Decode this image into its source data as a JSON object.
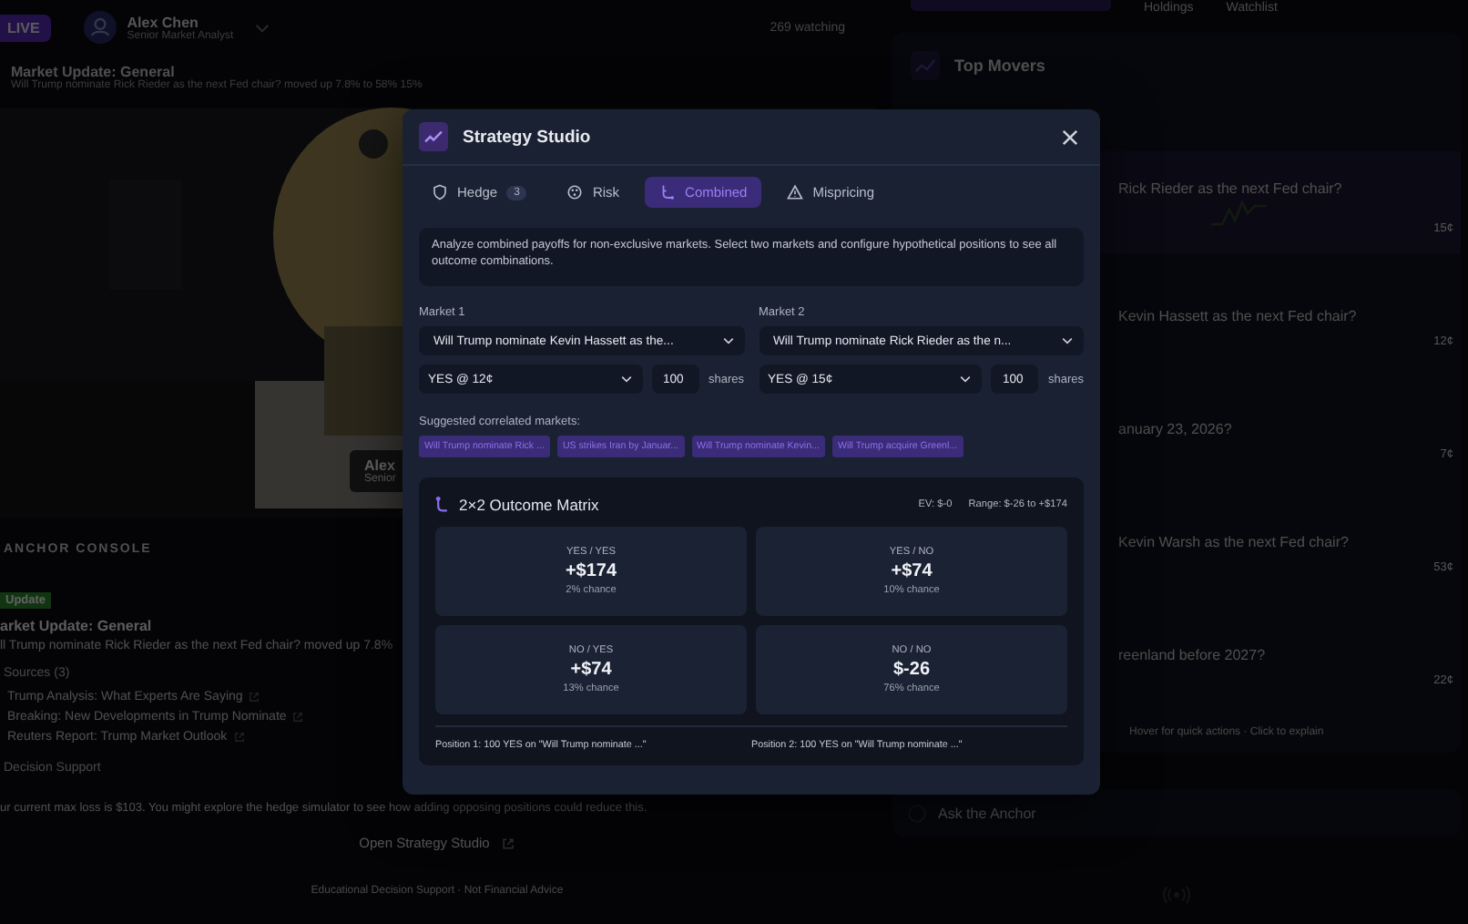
{
  "header": {
    "live_badge": "LIVE",
    "user_name": "Alex Chen",
    "user_role": "Senior Market Analyst",
    "viewers": "269 watching"
  },
  "ticker": {
    "title": "Market Update: General",
    "text": "Will Trump nominate Rick Rieder as the next Fed chair? moved up 7.8% to 58% 15%"
  },
  "video": {
    "kind": "picture",
    "name": "Alex",
    "role": "Senior"
  },
  "console": {
    "title": "ANCHOR CONSOLE",
    "badge": "Update",
    "headline": "arket Update: General",
    "text": "ll Trump nominate Rick Rieder as the next Fed chair? moved up 7.8%",
    "sources_title": "Sources (3)",
    "sources": [
      "Trump Analysis: What Experts Are Saying",
      "Breaking: New Developments in Trump Nominate",
      "Reuters Report: Trump Market Outlook"
    ],
    "decision_title": "Decision Support",
    "decision_text": "ur current max loss is $103. You might explore the hedge simulator to see how adding opposing positions could reduce this.",
    "open_button": "Open Strategy Studio",
    "footer": "Educational Decision Support · Not Financial Advice"
  },
  "side_tabs": [
    {
      "label": "Holdings",
      "selected": false
    },
    {
      "label": "Watchlist",
      "selected": false
    }
  ],
  "top_movers": {
    "title": "Top Movers",
    "rows": [
      {
        "question": "Rick Rieder as the next Fed chair?",
        "price": "15¢",
        "selected": true
      },
      {
        "question": "Kevin Hassett as the next Fed chair?",
        "price": "12¢",
        "selected": false
      },
      {
        "question": "anuary 23, 2026?",
        "price": "7¢",
        "selected": false
      },
      {
        "question": "Kevin Warsh as the next Fed chair?",
        "price": "53¢",
        "selected": false
      },
      {
        "question": "reenland before 2027?",
        "price": "22¢",
        "selected": false
      }
    ],
    "hint": "Hover for quick actions · Click to explain"
  },
  "ask": {
    "placeholder": "Ask the Anchor"
  },
  "modal": {
    "title": "Strategy Studio",
    "tabs": [
      {
        "label": "Hedge",
        "kind": "shield",
        "badge": "3",
        "selected": false
      },
      {
        "label": "Risk",
        "kind": "gauge",
        "selected": false
      },
      {
        "label": "Combined",
        "kind": "branch",
        "selected": true
      },
      {
        "label": "Mispricing",
        "kind": "warning",
        "selected": false
      }
    ],
    "info": "Analyze combined payoffs for non-exclusive markets. Select two markets and configure hypothetical positions to see all outcome combinations.",
    "markets": [
      {
        "label": "Market 1",
        "market": "Will Trump nominate Kevin Hassett as the...",
        "side": "YES @ 12¢",
        "shares": "100",
        "unit": "shares"
      },
      {
        "label": "Market 2",
        "market": "Will Trump nominate Rick Rieder as the n...",
        "side": "YES @ 15¢",
        "shares": "100",
        "unit": "shares"
      }
    ],
    "suggested_label": "Suggested correlated markets:",
    "suggested": [
      "Will Trump nominate Rick ...",
      "US strikes Iran by Januar...",
      "Will Trump nominate Kevin...",
      "Will Trump acquire Greenl..."
    ],
    "matrix": {
      "title": "2×2 Outcome Matrix",
      "ev": "EV: $-0",
      "range": "Range: $-26 to +$174",
      "cells": [
        {
          "label": "YES / YES",
          "value": "+$174",
          "chance": "2% chance"
        },
        {
          "label": "YES / NO",
          "value": "+$74",
          "chance": "10% chance"
        },
        {
          "label": "NO / YES",
          "value": "+$74",
          "chance": "13% chance"
        },
        {
          "label": "NO / NO",
          "value": "$-26",
          "chance": "76% chance"
        }
      ],
      "positions": [
        "Position 1: 100 YES on \"Will Trump nominate ...\"",
        "Position 2: 100 YES on \"Will Trump nominate ...\""
      ]
    }
  }
}
